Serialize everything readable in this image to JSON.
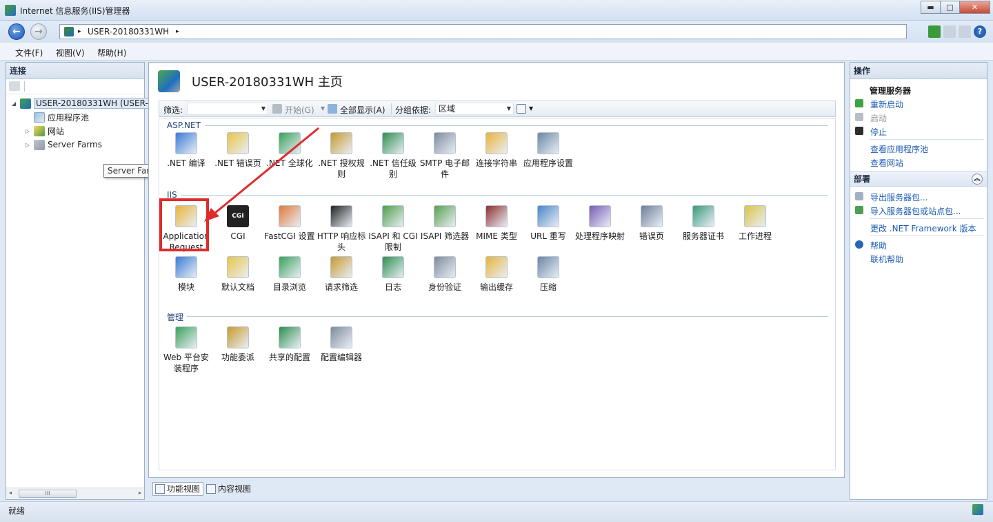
{
  "window": {
    "title": "Internet 信息服务(IIS)管理器",
    "minimize_label": "▬",
    "maximize_label": "□",
    "close_label": "✕"
  },
  "address": {
    "separator": "▸",
    "crumb": "USER-20180331WH",
    "trailing_separator": "▸"
  },
  "menu": {
    "file": "文件(F)",
    "view": "视图(V)",
    "help": "帮助(H)"
  },
  "connections": {
    "header": "连接",
    "tree": [
      {
        "label": "USER-20180331WH (USER-",
        "icon": "server-icon",
        "twisty": "◢"
      },
      {
        "label": "应用程序池",
        "icon": "app-pool-icon",
        "twisty": ""
      },
      {
        "label": "网站",
        "icon": "sites-icon",
        "twisty": "▷"
      },
      {
        "label": "Server Farms",
        "icon": "server-farms-icon",
        "twisty": "▷"
      }
    ],
    "tooltip": "Server Farms",
    "scroll_thumb": "III",
    "scroll_left": "◂",
    "scroll_right": "▸"
  },
  "home": {
    "title": "USER-20180331WH 主页",
    "filter_label": "筛选:",
    "filter_value": "",
    "go_label": "开始(G)",
    "show_all_label": "全部显示(A)",
    "group_by_label": "分组依据:",
    "group_by_value": "区域"
  },
  "groups": {
    "aspnet": "ASP.NET",
    "iis": "IIS",
    "manage": "管理"
  },
  "features": {
    "aspnet": [
      {
        "label": ".NET 编译",
        "icon": "net-compile-icon"
      },
      {
        "label": ".NET 错误页",
        "icon": "net-error-pages-icon"
      },
      {
        "label": ".NET 全球化",
        "icon": "net-globalization-icon"
      },
      {
        "label": ".NET 授权规则",
        "icon": "net-authorization-icon"
      },
      {
        "label": ".NET 信任级别",
        "icon": "net-trust-levels-icon"
      },
      {
        "label": "SMTP 电子邮件",
        "icon": "smtp-email-icon"
      },
      {
        "label": "连接字符串",
        "icon": "connection-strings-icon"
      },
      {
        "label": "应用程序设置",
        "icon": "app-settings-icon"
      }
    ],
    "iis_row1": [
      {
        "label": "Application Request",
        "icon": "application-request-routing-icon"
      },
      {
        "label": "CGI",
        "icon": "cgi-icon"
      },
      {
        "label": "FastCGI 设置",
        "icon": "fastcgi-icon"
      },
      {
        "label": "HTTP 响应标头",
        "icon": "http-response-headers-icon"
      },
      {
        "label": "ISAPI 和 CGI 限制",
        "icon": "isapi-cgi-restrictions-icon"
      },
      {
        "label": "ISAPI 筛选器",
        "icon": "isapi-filters-icon"
      },
      {
        "label": "MIME 类型",
        "icon": "mime-types-icon"
      },
      {
        "label": "URL 重写",
        "icon": "url-rewrite-icon"
      },
      {
        "label": "处理程序映射",
        "icon": "handler-mappings-icon"
      },
      {
        "label": "错误页",
        "icon": "error-pages-icon"
      },
      {
        "label": "服务器证书",
        "icon": "server-certificates-icon"
      },
      {
        "label": "工作进程",
        "icon": "worker-processes-icon"
      }
    ],
    "iis_row2": [
      {
        "label": "模块",
        "icon": "modules-icon"
      },
      {
        "label": "默认文档",
        "icon": "default-document-icon"
      },
      {
        "label": "目录浏览",
        "icon": "directory-browsing-icon"
      },
      {
        "label": "请求筛选",
        "icon": "request-filtering-icon"
      },
      {
        "label": "日志",
        "icon": "logging-icon"
      },
      {
        "label": "身份验证",
        "icon": "authentication-icon"
      },
      {
        "label": "输出缓存",
        "icon": "output-caching-icon"
      },
      {
        "label": "压缩",
        "icon": "compression-icon"
      }
    ],
    "manage": [
      {
        "label": "Web 平台安装程序",
        "icon": "web-platform-installer-icon"
      },
      {
        "label": "功能委派",
        "icon": "feature-delegation-icon"
      },
      {
        "label": "共享的配置",
        "icon": "shared-configuration-icon"
      },
      {
        "label": "配置编辑器",
        "icon": "configuration-editor-icon"
      }
    ],
    "cgi_icon_text": "CGI"
  },
  "view_tabs": {
    "features_view": "功能视图",
    "content_view": "内容视图"
  },
  "actions": {
    "header": "操作",
    "manage_server": "管理服务器",
    "restart": "重新启动",
    "start": "启动",
    "stop": "停止",
    "view_app_pools": "查看应用程序池",
    "view_sites": "查看网站",
    "deploy_header": "部署",
    "export_server_package": "导出服务器包...",
    "import_package": "导入服务器包或站点包...",
    "change_framework": "更改 .NET Framework 版本",
    "help": "帮助",
    "online_help": "联机帮助",
    "collapse_glyph": "︽"
  },
  "status": {
    "text": "就绪"
  },
  "colors": {
    "highlight_box": "#e02b2b",
    "link": "#1c5ab2",
    "group_label": "#1f3f7a"
  }
}
